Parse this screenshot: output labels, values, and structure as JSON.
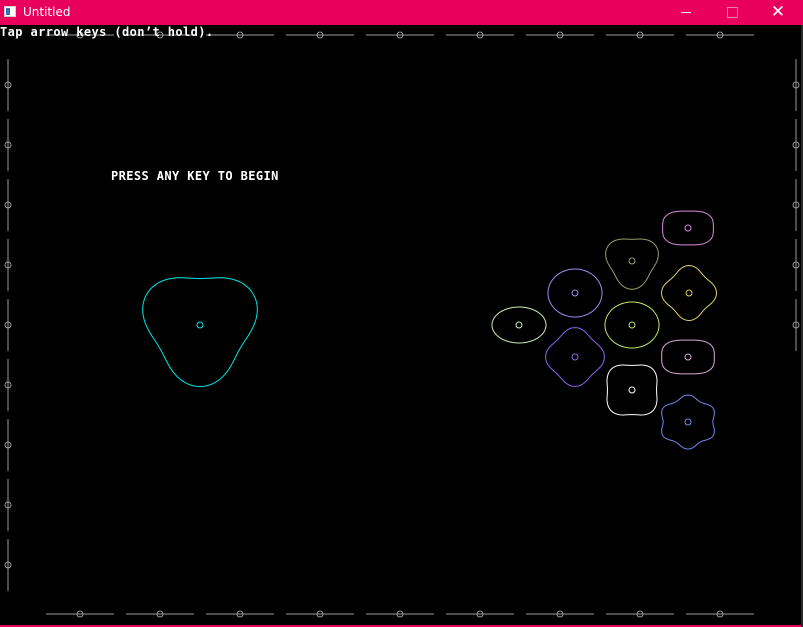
{
  "window": {
    "title": "Untitled",
    "accent_color": "#e9005d",
    "controls": [
      "minimize",
      "maximize",
      "close"
    ],
    "close_glyph": "✕"
  },
  "game": {
    "hint": "Tap arrow keys (don’t hold).",
    "prompt": "PRESS ANY KEY TO BEGIN",
    "player": {
      "color": "#00e5e5",
      "shape": "three-lobed blob"
    },
    "targets": [
      {
        "id": "t1",
        "color": "#e08ae0",
        "shape": "rounded rectangle"
      },
      {
        "id": "t2",
        "color": "#9a9a70",
        "shape": "three-lobed blob"
      },
      {
        "id": "t3",
        "color": "#9b8cf0",
        "shape": "oval"
      },
      {
        "id": "t4",
        "color": "#e0cf6a",
        "shape": "four-lobed blob"
      },
      {
        "id": "t5",
        "color": "#c8f0b0",
        "shape": "oval"
      },
      {
        "id": "t6",
        "color": "#c0e870",
        "shape": "oval"
      },
      {
        "id": "t7",
        "color": "#9060f0",
        "shape": "four-lobed blob"
      },
      {
        "id": "t8",
        "color": "#d8a8d8",
        "shape": "oval"
      },
      {
        "id": "t9",
        "color": "#ffffff",
        "shape": "four-lobed blob"
      },
      {
        "id": "t10",
        "color": "#6a8cf0",
        "shape": "six-lobed blob"
      }
    ],
    "border_color": "#9a9a9a"
  }
}
